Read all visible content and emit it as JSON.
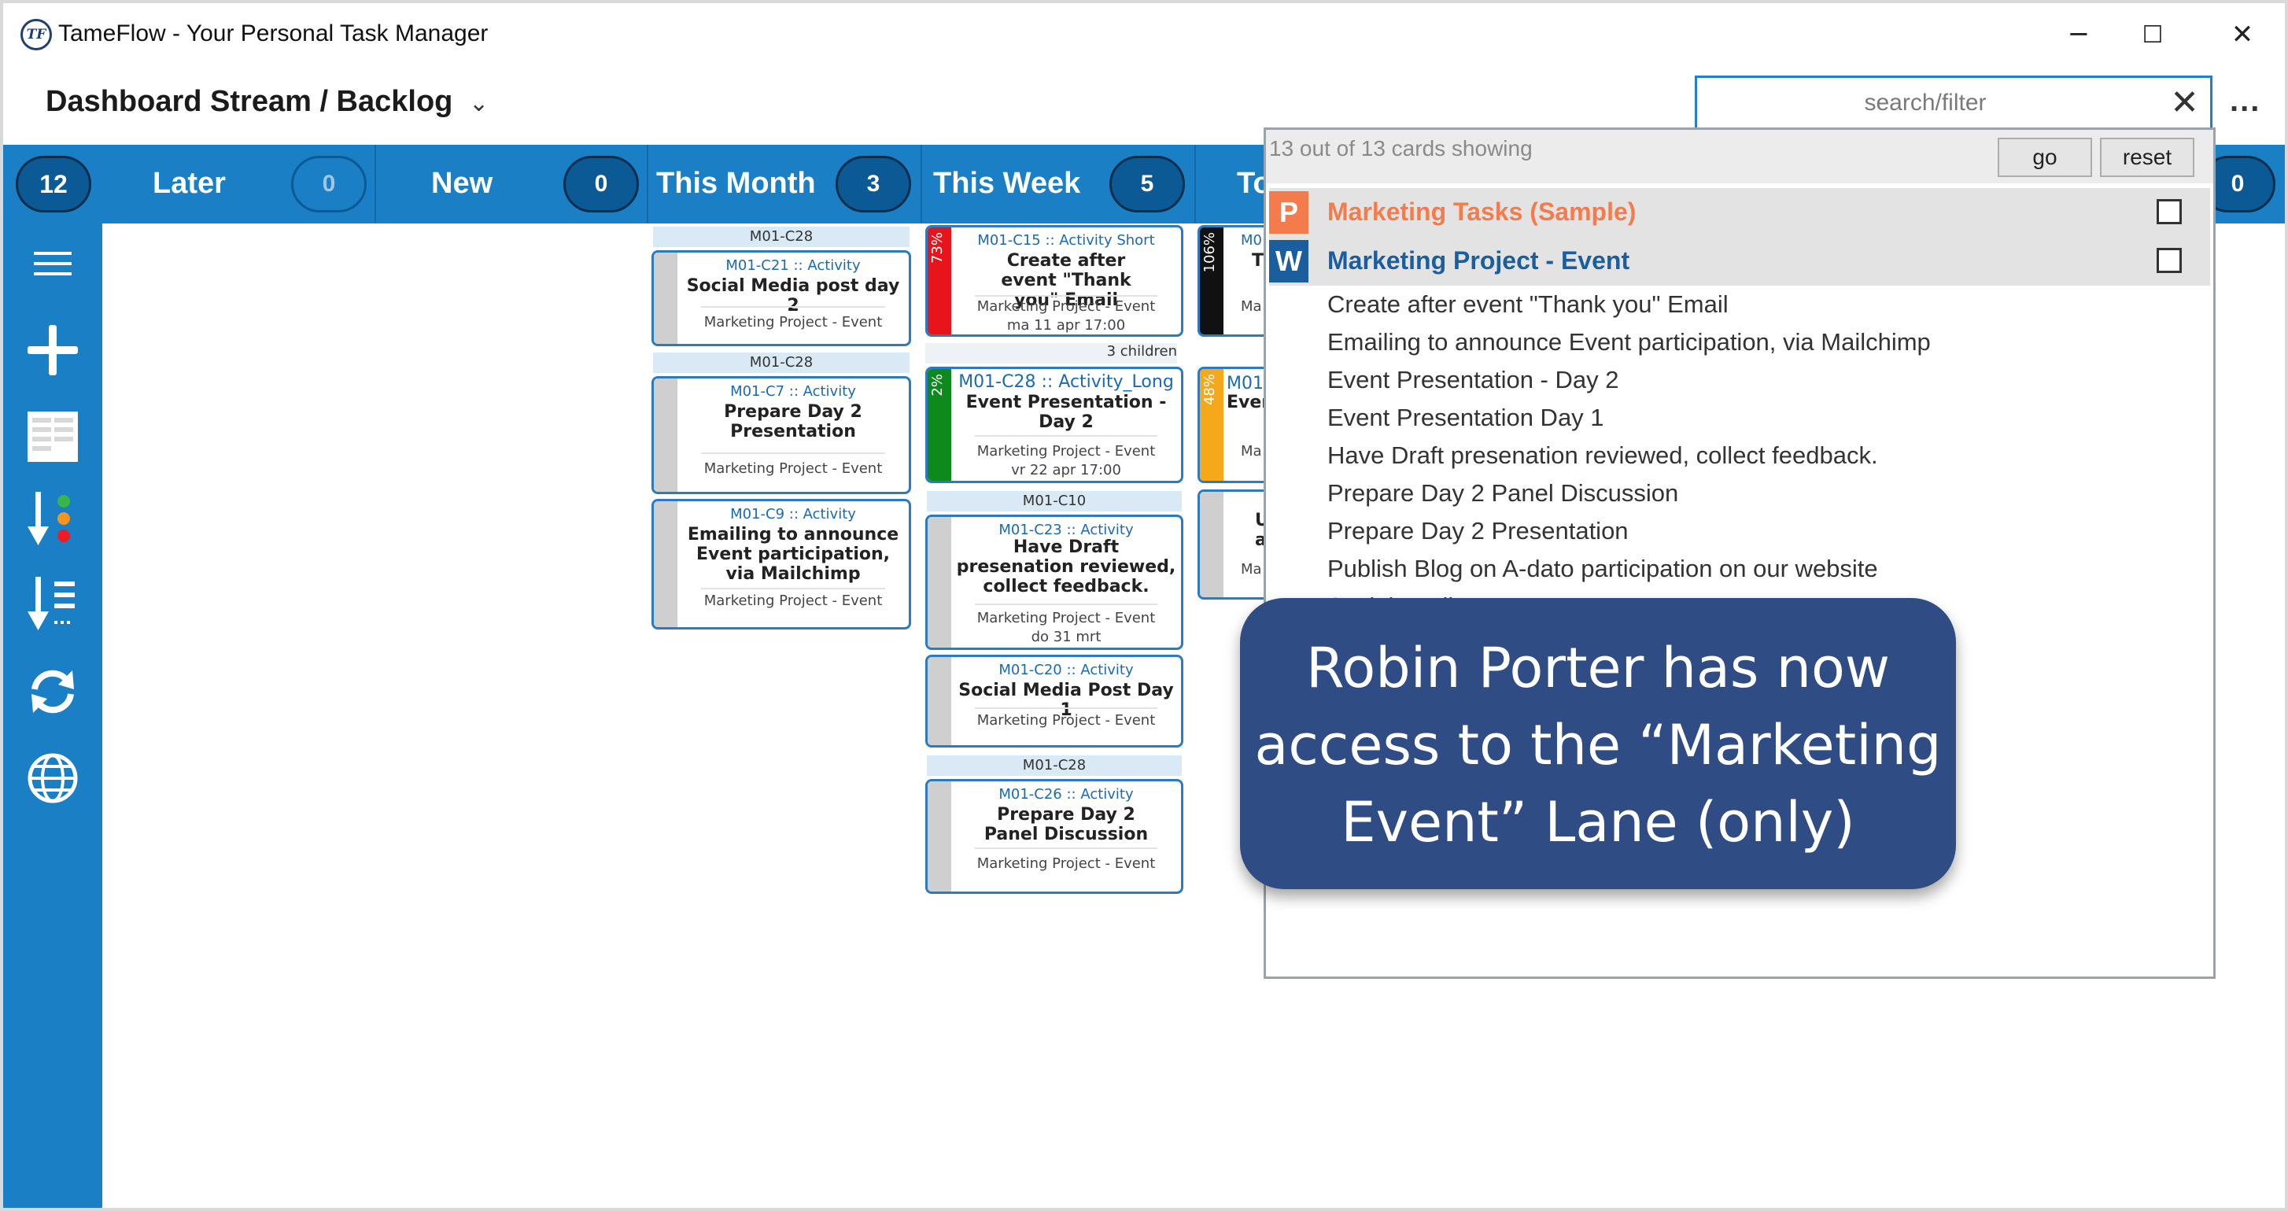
{
  "window": {
    "logo_text": "TF",
    "title": "TameFlow - Your Personal Task Manager",
    "minimize": "─",
    "maximize": "☐",
    "close": "✕"
  },
  "header": {
    "title": "Dashboard Stream / Backlog",
    "chevron": "⌄",
    "search_placeholder": "search/filter",
    "search_clear": "✕",
    "more": "..."
  },
  "columns": {
    "total": "12",
    "later": {
      "label": "Later",
      "count": "0"
    },
    "new": {
      "label": "New",
      "count": "0"
    },
    "this_month": {
      "label": "This Month",
      "count": "3"
    },
    "this_week": {
      "label": "This Week",
      "count": "5"
    },
    "today": {
      "label": "To",
      "count": "0"
    }
  },
  "sidebar": {
    "icons": [
      "menu-icon",
      "add-icon",
      "table-icon",
      "sort-priority-icon",
      "sort-list-icon",
      "refresh-icon",
      "globe-icon"
    ]
  },
  "cards": {
    "g1_label": "M01-C28",
    "c1_id": "M01-C21 :: Activity",
    "c1_title": "Social Media post day 2",
    "c1_proj": "Marketing Project  - Event",
    "g2_label": "M01-C28",
    "c2_id": "M01-C7 :: Activity",
    "c2_title": "Prepare Day 2 Presentation",
    "c2_proj": "Marketing Project  - Event",
    "c3_id": "M01-C9 :: Activity",
    "c3_title": "Emailing to announce Event participation, via Mailchimp",
    "c3_proj": "Marketing Project  - Event",
    "c4_id": "M01-C15 :: Activity  Short",
    "c4_title": "Create after event \"Thank you\" Email",
    "c4_proj": "Marketing Project  - Event",
    "c4_date": "ma 11 apr 17:00",
    "c4_pct": "73%",
    "children": "3 children",
    "c5_id": "M01-C28 :: Activity_Long",
    "c5_title": "Event  Presentation - Day 2",
    "c5_proj": "Marketing Project  - Event",
    "c5_date": "vr 22 apr 17:00",
    "c5_pct": "2%",
    "g3_label": "M01-C10",
    "c6_id": "M01-C23 :: Activity",
    "c6_title": "Have Draft presenation reviewed, collect feedback.",
    "c6_proj": "Marketing Project  - Event",
    "c6_date": "do 31 mrt",
    "c7_id": "M01-C20 :: Activity",
    "c7_title": "Social Media Post Day 1",
    "c7_proj": "Marketing Project  - Event",
    "g4_label": "M01-C28",
    "c8_id": "M01-C26 :: Activity",
    "c8_title": "Prepare Day 2 Panel Discussion",
    "c8_proj": "Marketing Project  - Event",
    "c9_id": "M0",
    "c9_title": "T",
    "c9_proj": "Ma",
    "c9_pct": "106%",
    "c10_id": "M01-",
    "c10_title": "Even",
    "c10_proj": "Ma",
    "c10_pct": "48%",
    "c11_title": "U a",
    "c11_proj": "Ma"
  },
  "filter": {
    "count_text": "13 out of 13 cards showing",
    "go": "go",
    "reset": "reset",
    "projects": [
      {
        "letter": "P",
        "name": "Marketing Tasks (Sample)",
        "color": "#f47c4c"
      },
      {
        "letter": "W",
        "name": "Marketing Project  - Event",
        "color": "#1b5e9e"
      }
    ],
    "tasks": [
      "Create after event \"Thank you\" Email",
      "Emailing to announce Event participation, via Mailchimp",
      "Event  Presentation - Day 2",
      "Event Presentation Day 1",
      "Have Draft presenation reviewed, collect feedback.",
      "Prepare Day 2 Panel Discussion",
      "Prepare Day 2 Presentation",
      "Publish Blog on A-dato participation on our website",
      "Social Media Post Day 1"
    ]
  },
  "callout": {
    "text": "Robin Porter has now access to the “Marketing Event” Lane (only)"
  },
  "colors": {
    "accent_blue": "#1a7fc4",
    "card_border": "#2c7ac0",
    "callout_bg": "#2f4c84",
    "pct_red": "#e8141c",
    "pct_green": "#0e8a1c",
    "pct_black": "#111111",
    "pct_orange": "#f4a81a"
  }
}
